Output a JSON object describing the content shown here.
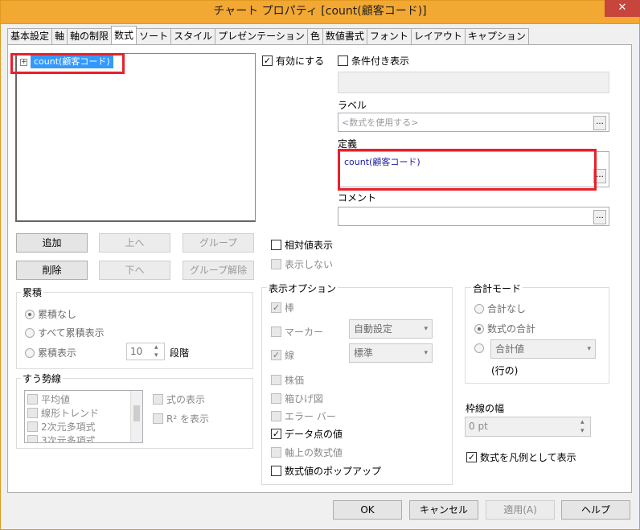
{
  "window": {
    "title": "チャート プロパティ [count(顧客コード)]",
    "close": "✕"
  },
  "tabs": [
    "基本設定",
    "軸",
    "軸の制限",
    "数式",
    "ソート",
    "スタイル",
    "プレゼンテーション",
    "色",
    "数値書式",
    "フォント",
    "レイアウト",
    "キャプション"
  ],
  "tree": {
    "expand": "+",
    "item": "count(顧客コード)"
  },
  "buttons": {
    "add": "追加",
    "up": "上へ",
    "group": "グループ",
    "delete": "削除",
    "down": "下へ",
    "ungroup": "グループ解除"
  },
  "expr": {
    "enabled": "有効にする",
    "conditional": "条件付き表示",
    "label_title": "ラベル",
    "label_placeholder": "<数式を使用する>",
    "def_title": "定義",
    "definition": "count(顧客コード)",
    "comment_title": "コメント",
    "ellipsis": "..."
  },
  "relative": "相対値表示",
  "hide": "表示しない",
  "accum": {
    "title": "累積",
    "none": "累積なし",
    "all": "すべて累積表示",
    "show": "累積表示",
    "steps": "10",
    "steps_label": "段階"
  },
  "trend": {
    "title": "すう勢線",
    "items": [
      "平均値",
      "線形トレンド",
      "2次元多項式",
      "3次元多項式"
    ],
    "show_expr": "式の表示",
    "show_r2": "R² を表示"
  },
  "display": {
    "title": "表示オプション",
    "bar": "棒",
    "marker": "マーカー",
    "marker_value": "自動設定",
    "line": "線",
    "line_value": "標準",
    "stock": "株価",
    "box": "箱ひげ図",
    "error": "エラー バー",
    "data_values": "データ点の値",
    "axis_values": "軸上の数式値",
    "popup": "数式値のポップアップ"
  },
  "total": {
    "title": "合計モード",
    "none": "合計なし",
    "sum": "数式の合計",
    "total_value": "合計値",
    "rows": "(行の)"
  },
  "border": {
    "title": "枠線の幅",
    "value": "0 pt"
  },
  "legend": "数式を凡例として表示",
  "footer": {
    "ok": "OK",
    "cancel": "キャンセル",
    "apply": "適用(A)",
    "help": "ヘルプ"
  },
  "glyphs": {
    "check": "✓",
    "arrow_down": "▾",
    "spin_up": "▴",
    "spin_down": "▾"
  }
}
